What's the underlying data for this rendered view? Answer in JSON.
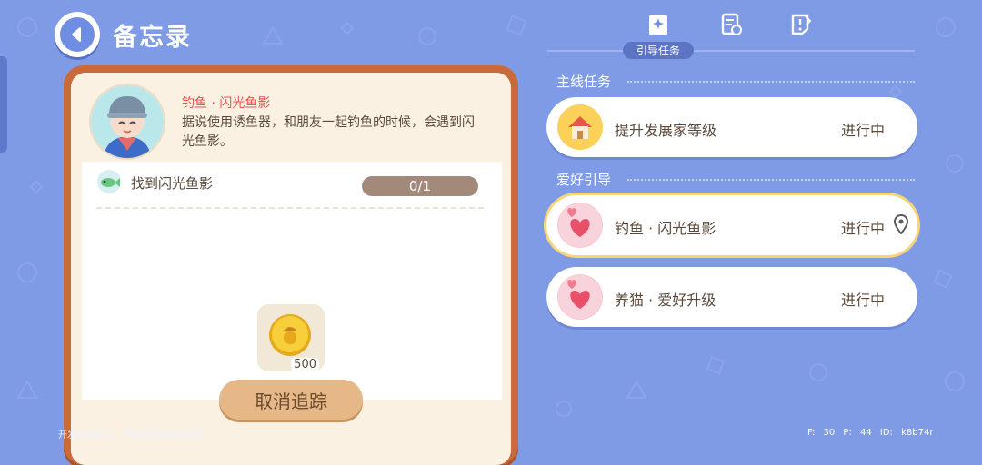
{
  "header": {
    "title": "备忘录"
  },
  "tabs": [
    {
      "icon": "guide-book-icon",
      "label": "引导任务",
      "active": true
    },
    {
      "icon": "quest-scroll-icon"
    },
    {
      "icon": "hint-note-icon"
    }
  ],
  "detail": {
    "task_name": "钓鱼 · 闪光鱼影",
    "description": "据说使用诱鱼器，和朋友一起钓鱼的时候，会遇到闪光鱼影。",
    "goal": {
      "text": "找到闪光鱼影",
      "progress": "0/1",
      "progress_value": 0
    },
    "reward": {
      "icon": "coin-icon",
      "count": "500"
    },
    "cancel_label": "取消追踪"
  },
  "sections": {
    "main": {
      "title": "主线任务",
      "quests": [
        {
          "name": "提升发展家等级",
          "status": "进行中",
          "icon": "house-icon"
        }
      ]
    },
    "hobby": {
      "title": "爱好引导",
      "quests": [
        {
          "name": "钓鱼 · 闪光鱼影",
          "status": "进行中",
          "icon": "heart-icon",
          "selected": true,
          "tracked": true
        },
        {
          "name": "养猫 · 爱好升级",
          "status": "进行中",
          "icon": "heart-icon"
        }
      ]
    }
  },
  "footer": {
    "watermark": "开发测试版本，不代表游戏最终品质",
    "debug": "F: 30  P: 44  ID: k8b74r"
  },
  "colors": {
    "background": "#7f9be6",
    "card_frame": "#c96a3a",
    "accent_red": "#e6524e",
    "selected_outline": "#f6d678"
  }
}
